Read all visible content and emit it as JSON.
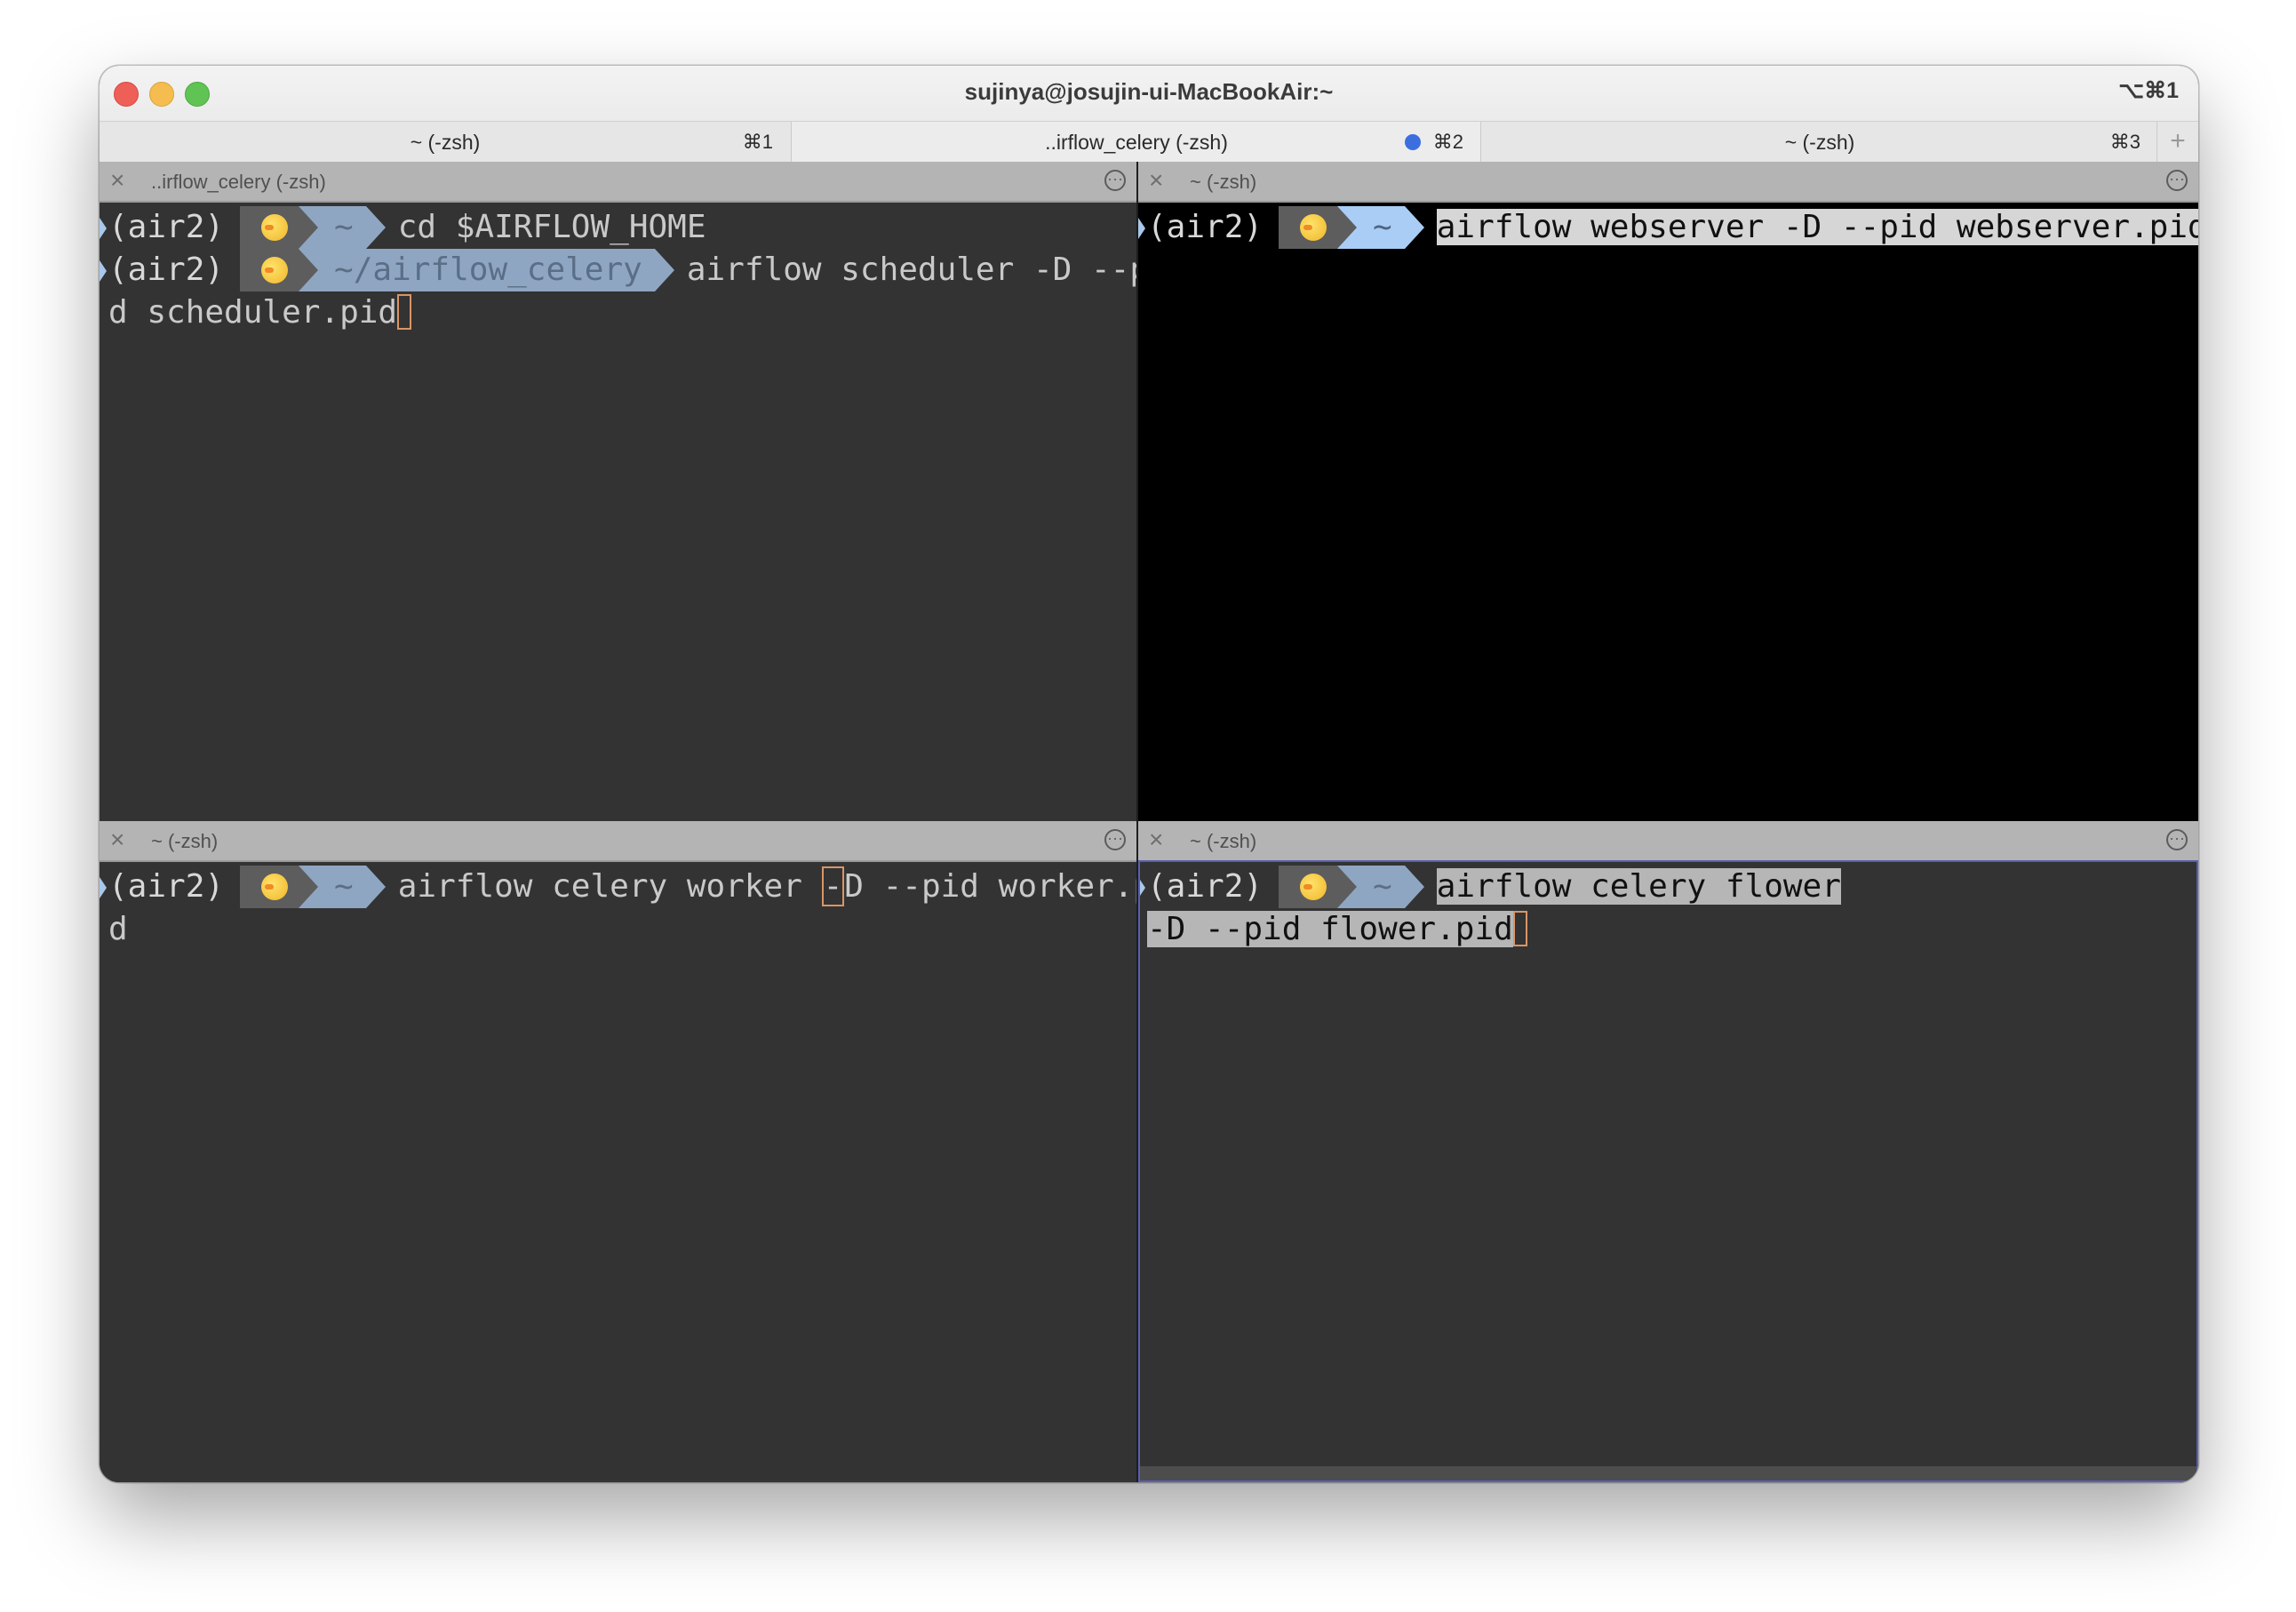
{
  "window": {
    "title": "sujinya@josujin-ui-MacBookAir:~",
    "shortcut": "⌥⌘1"
  },
  "tabs": [
    {
      "label": "~ (-zsh)",
      "key": "⌘1",
      "active": false
    },
    {
      "label": "..irflow_celery (-zsh)",
      "key": "⌘2",
      "active": true,
      "dot": true
    },
    {
      "label": "~ (-zsh)",
      "key": "⌘3",
      "active": false
    }
  ],
  "tab_add_symbol": "+",
  "panes": {
    "top_left": {
      "title": "..irflow_celery (-zsh)",
      "lines": [
        {
          "venv": "(air2)",
          "dir": "~",
          "cmd": "cd $AIRFLOW_HOME"
        },
        {
          "venv": "(air2)",
          "dir": "~/airflow_celery",
          "cmd": "airflow scheduler -D --pi"
        }
      ],
      "wrap": "d scheduler.pid"
    },
    "top_right": {
      "title": "~ (-zsh)",
      "lines": [
        {
          "venv": "(air2)",
          "dir": "~",
          "cmd": "airflow webserver -D --pid webserver.pid"
        }
      ]
    },
    "bottom_left": {
      "title": "~ (-zsh)",
      "lines": [
        {
          "venv": "(air2)",
          "dir": "~",
          "cmd_before": "airflow celery worker ",
          "cmd_cursor": "-",
          "cmd_after": "D --pid worker.pi"
        }
      ],
      "wrap": "d"
    },
    "bottom_right": {
      "title": "~ (-zsh)",
      "lines": [
        {
          "venv": "(air2)",
          "dir": "~",
          "cmd": "airflow celery flower"
        }
      ],
      "wrap": "-D --pid flower.pid"
    }
  },
  "icons": {
    "close": "close-icon",
    "menu": "more-icon",
    "prompt_emoji": "duck-icon"
  },
  "colors": {
    "close_button": "#ee5f57",
    "minimize_button": "#f5bd4f",
    "zoom_button": "#60c454",
    "tab_activity_dot": "#3b6fe0",
    "cursor": "#f0a878",
    "path_segment": "#8fa6c2"
  }
}
